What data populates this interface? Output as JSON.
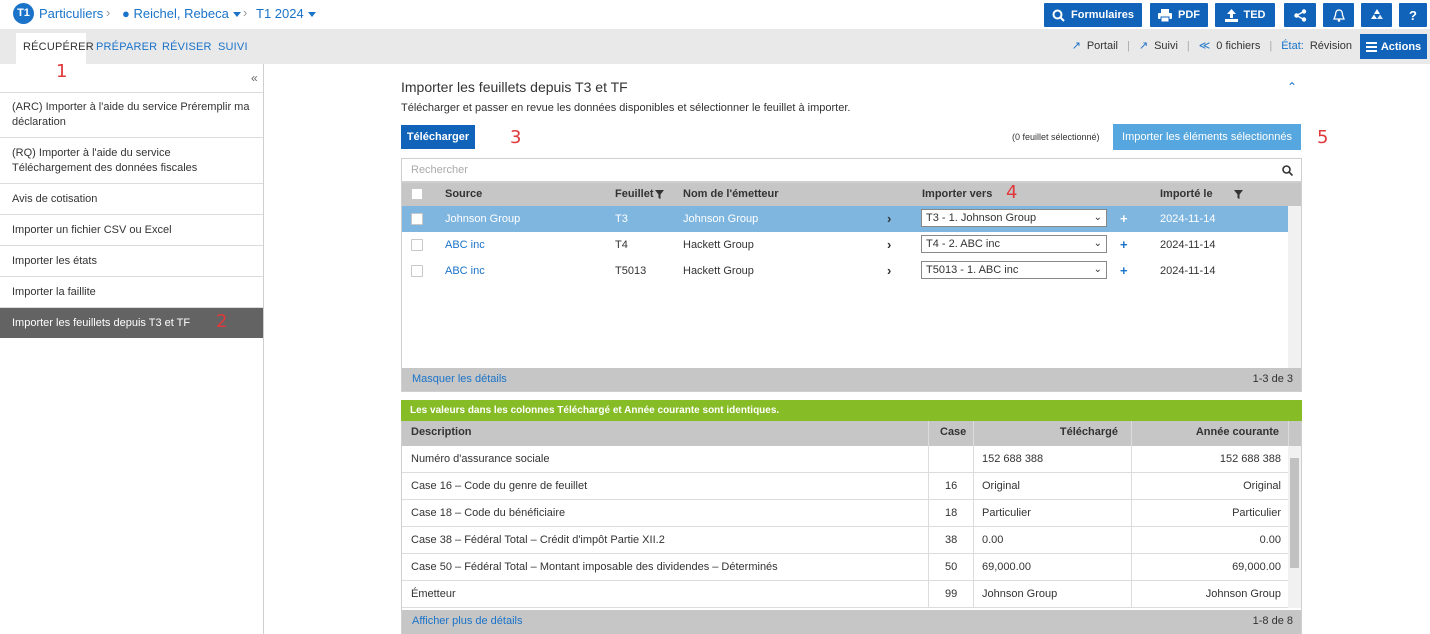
{
  "breadcrumb": {
    "badge": "T1",
    "items": [
      "Particuliers",
      "Reichel, Rebeca",
      "T1 2024"
    ]
  },
  "toolbar": {
    "formulaires": "Formulaires",
    "pdf": "PDF",
    "ted": "TED"
  },
  "tabs": [
    "RÉCUPÉRER",
    "PRÉPARER",
    "RÉVISER",
    "SUIVI"
  ],
  "status_links": {
    "portail": "Portail",
    "suivi": "Suivi",
    "fichiers": "0 fichiers",
    "etat_label": "État:",
    "etat_value": "Révision",
    "actions": "Actions"
  },
  "step_markers": [
    "1",
    "2",
    "3",
    "4",
    "5"
  ],
  "sidebar": {
    "collapse": "«",
    "items": [
      "(ARC) Importer à l'aide du service Préremplir ma déclaration",
      "(RQ) Importer à l'aide du service Téléchargement des données fiscales",
      "Avis de cotisation",
      "Importer un fichier CSV ou Excel",
      "Importer les états",
      "Importer la faillite",
      "Importer les feuillets depuis T3 et TF"
    ]
  },
  "main": {
    "title": "Importer les feuillets depuis T3 et TF",
    "subtitle": "Télécharger et passer en revue les données disponibles et sélectionner le feuillet à importer.",
    "download_button": "Télécharger",
    "selected_count": "(0 feuillet sélectionné)",
    "import_button": "Importer les éléments sélectionnés",
    "search_placeholder": "Rechercher"
  },
  "slips_table": {
    "headers": [
      "Source",
      "Feuillet",
      "Nom de l'émetteur",
      "Importer vers",
      "Importé le"
    ],
    "rows": [
      {
        "source": "Johnson Group",
        "feuillet": "T3",
        "emetteur": "Johnson Group",
        "importer_vers": "T3 - 1. Johnson Group",
        "importe_le": "2024-11-14"
      },
      {
        "source": "ABC inc",
        "feuillet": "T4",
        "emetteur": "Hackett Group",
        "importer_vers": "T4 - 2. ABC inc",
        "importe_le": "2024-11-14"
      },
      {
        "source": "ABC inc",
        "feuillet": "T5013",
        "emetteur": "Hackett Group",
        "importer_vers": "T5013 - 1. ABC inc",
        "importe_le": "2024-11-14"
      }
    ],
    "footer_link": "Masquer les détails",
    "footer_count": "1-3 de 3"
  },
  "details": {
    "banner": "Les valeurs dans les colonnes Téléchargé et Année courante sont identiques.",
    "headers": [
      "Description",
      "Case",
      "Téléchargé",
      "Année courante"
    ],
    "rows": [
      {
        "description": "Numéro d'assurance sociale",
        "case": "",
        "telecharge": "152 688 388",
        "annee": "152 688 388"
      },
      {
        "description": "Case 16 – Code du genre de feuillet",
        "case": "16",
        "telecharge": "Original",
        "annee": "Original"
      },
      {
        "description": "Case 18 – Code du bénéficiaire",
        "case": "18",
        "telecharge": "Particulier",
        "annee": "Particulier"
      },
      {
        "description": "Case 38 – Fédéral Total – Crédit d'impôt Partie XII.2",
        "case": "38",
        "telecharge": "0.00",
        "annee": "0.00"
      },
      {
        "description": "Case 50 – Fédéral Total – Montant imposable des dividendes – Déterminés",
        "case": "50",
        "telecharge": "69,000.00",
        "annee": "69,000.00"
      },
      {
        "description": "Émetteur",
        "case": "99",
        "telecharge": "Johnson Group",
        "annee": "Johnson Group"
      }
    ],
    "footer_link": "Afficher plus de détails",
    "footer_count": "1-8 de 8"
  },
  "colors": {
    "primary": "#1063b8",
    "link": "#1a73c9",
    "highlight_row": "#7fb6e0",
    "banner_green": "#86bc25",
    "selected_sidebar": "#636363",
    "step_marker_red": "#e0383b"
  }
}
